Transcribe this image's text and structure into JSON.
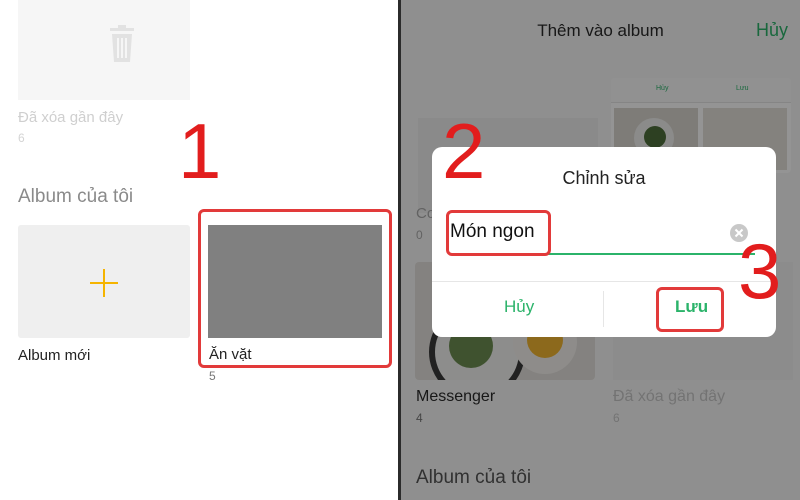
{
  "left": {
    "deleted_album": {
      "label": "Đã xóa gần đây",
      "count": "6"
    },
    "section_title": "Album của tôi",
    "new_album": {
      "label": "Album mới"
    },
    "snack_album": {
      "label": "Ăn vặt",
      "count": "5"
    }
  },
  "right": {
    "header": {
      "title": "Thêm vào album",
      "cancel": "Hủy"
    },
    "mini_dialog": {
      "cancel": "Hủy",
      "save": "Lưu"
    },
    "albums": [
      {
        "label": "Messenger",
        "count": "4"
      },
      {
        "label": "Đã xóa gần đây",
        "count": "6"
      }
    ],
    "partial_label": "Co",
    "partial_count": "0",
    "section_title": "Album của tôi",
    "dialog": {
      "title": "Chỉnh sửa",
      "input_value": "Món ngon",
      "cancel": "Hủy",
      "save": "Lưu"
    }
  },
  "steps": [
    "1",
    "2",
    "3"
  ],
  "colors": {
    "accent_green": "#2bb36a",
    "highlight_red": "#e23a3a",
    "plus_yellow": "#f5b400"
  },
  "icons": [
    "trash-icon",
    "plus-icon",
    "clear-input-icon"
  ]
}
